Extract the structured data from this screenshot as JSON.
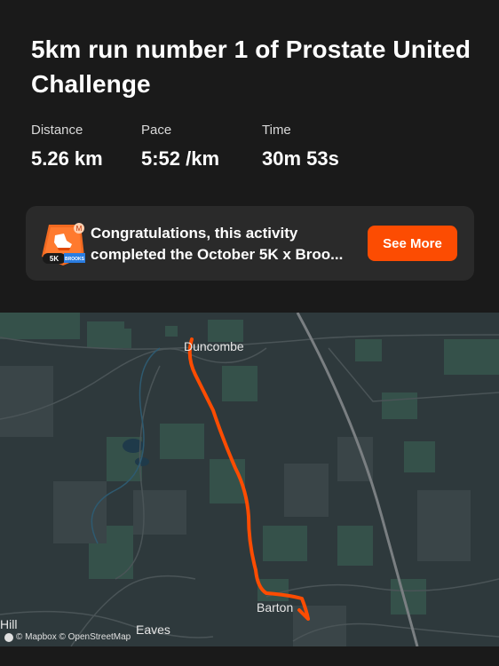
{
  "activity": {
    "title": "5km run number 1 of Prostate United Challenge"
  },
  "stats": [
    {
      "label": "Distance",
      "value": "5.26 km"
    },
    {
      "label": "Pace",
      "value": "5:52 /km"
    },
    {
      "label": "Time",
      "value": "30m 53s"
    }
  ],
  "banner": {
    "badge_text": "5K",
    "badge_brand": "BROOKS",
    "line1": "Congratulations, this activity",
    "line2": "completed the October 5K x Broo...",
    "button_label": "See More"
  },
  "map": {
    "places": {
      "duncombe": "Duncombe",
      "barton": "Barton",
      "eaves": "Eaves",
      "hill": "Hill"
    },
    "attribution": "© Mapbox © OpenStreetMap",
    "route_color": "#fc4c02",
    "background_color": "#2e393c"
  },
  "colors": {
    "accent": "#fc4c02",
    "background": "#1a1a1a",
    "card": "#2a2a2a"
  }
}
